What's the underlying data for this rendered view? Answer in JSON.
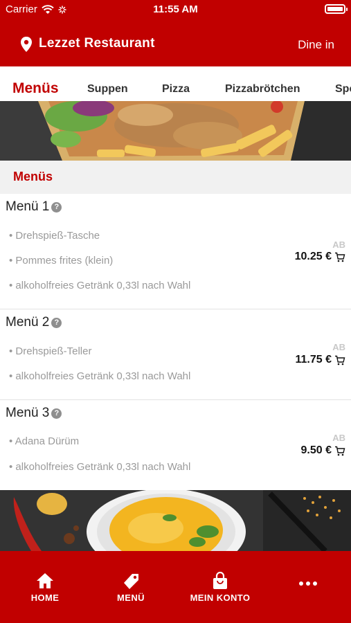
{
  "status": {
    "carrier": "Carrier",
    "time": "11:55 AM"
  },
  "header": {
    "restaurant": "Lezzet Restaurant",
    "mode": "Dine in"
  },
  "tabs": [
    {
      "label": "Menüs"
    },
    {
      "label": "Suppen"
    },
    {
      "label": "Pizza"
    },
    {
      "label": "Pizzabrötchen"
    },
    {
      "label": "Spe"
    }
  ],
  "section": {
    "title": "Menüs"
  },
  "items": [
    {
      "title": "Menü 1",
      "lines": [
        "• Drehspieß-Tasche",
        "• Pommes frites (klein)",
        "• alkoholfreies Getränk 0,33l nach Wahl"
      ],
      "ab": "AB",
      "price": "10.25 €"
    },
    {
      "title": "Menü 2",
      "lines": [
        "• Drehspieß-Teller",
        "• alkoholfreies Getränk 0,33l nach Wahl"
      ],
      "ab": "AB",
      "price": "11.75 €"
    },
    {
      "title": "Menü 3",
      "lines": [
        "• Adana Dürüm",
        "• alkoholfreies Getränk 0,33l nach Wahl"
      ],
      "ab": "AB",
      "price": "9.50 €"
    }
  ],
  "nav": {
    "home": "HOME",
    "menu": "MENÜ",
    "account": "MEIN KONTO"
  },
  "colors": {
    "brand": "#c10000",
    "section_bg": "#f1f1f1"
  }
}
